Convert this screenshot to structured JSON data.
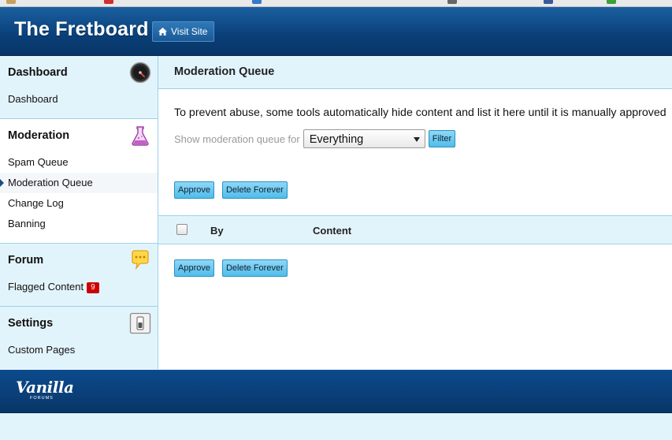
{
  "header": {
    "site_title": "The Fretboard",
    "visit_site_label": "Visit Site"
  },
  "sidebar": {
    "sections": [
      {
        "title": "Dashboard",
        "icon": "dashboard-gauge-icon",
        "items": [
          {
            "label": "Dashboard"
          }
        ]
      },
      {
        "title": "Moderation",
        "icon": "flask-icon",
        "items": [
          {
            "label": "Spam Queue"
          },
          {
            "label": "Moderation Queue",
            "active": true
          },
          {
            "label": "Change Log"
          },
          {
            "label": "Banning"
          }
        ]
      },
      {
        "title": "Forum",
        "icon": "speech-bubble-icon",
        "items": [
          {
            "label": "Flagged Content",
            "badge": "9"
          }
        ]
      },
      {
        "title": "Settings",
        "icon": "switch-icon",
        "items": [
          {
            "label": "Custom Pages"
          }
        ]
      }
    ]
  },
  "main": {
    "heading": "Moderation Queue",
    "intro": "To prevent abuse, some tools automatically hide content and list it here until it is manually approved",
    "filter": {
      "label": "Show moderation queue for",
      "selected": "Everything",
      "button_label": "Filter"
    },
    "actions": {
      "approve_label": "Approve",
      "delete_label": "Delete Forever"
    },
    "table": {
      "columns": [
        "By",
        "Content"
      ]
    }
  },
  "footer": {
    "logo_text": "Vanilla",
    "logo_sub": "FORUMS"
  },
  "colors": {
    "header_blue": "#0a3f78",
    "sidebar_light": "#e2f4fb",
    "button_blue": "#4fbde9",
    "badge_red": "#cc0000"
  }
}
